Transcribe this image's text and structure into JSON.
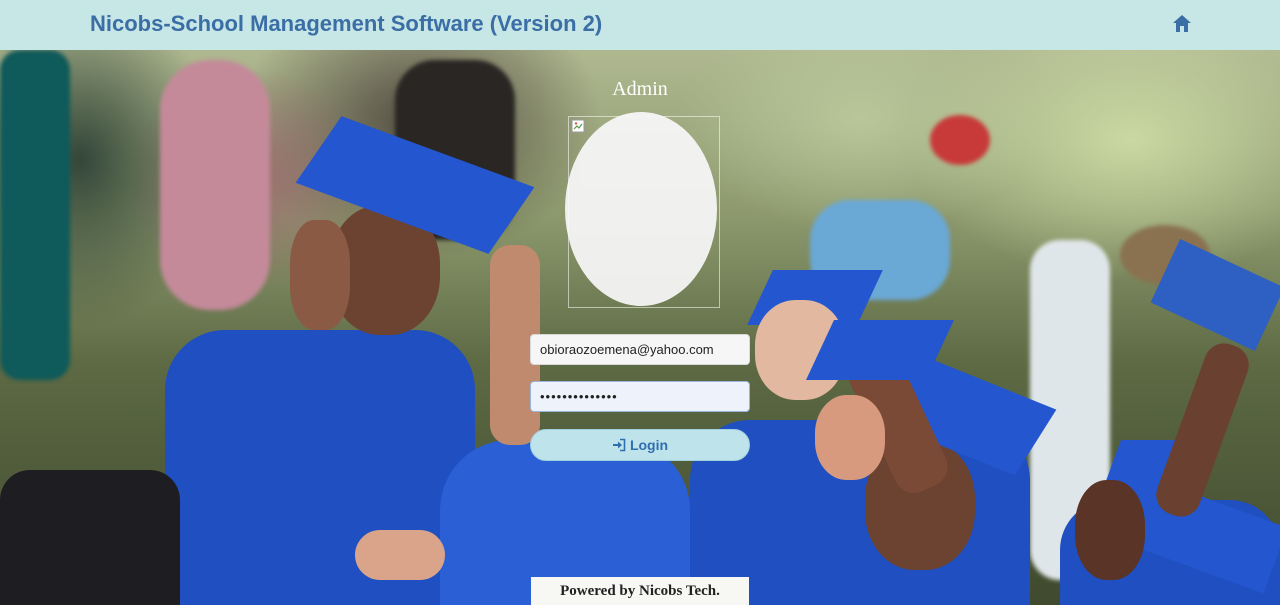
{
  "header": {
    "title": "Nicobs-School Management Software (Version 2)",
    "home_icon": "home-icon"
  },
  "login": {
    "heading": "Admin",
    "avatar_icon": "broken-image-icon",
    "email_value": "obioraozoemena@yahoo.com",
    "password_value": "••••••••••••••",
    "login_label": "Login",
    "login_icon": "sign-in-icon"
  },
  "footer": {
    "text": "Powered by Nicobs Tech."
  },
  "colors": {
    "header_bg": "#c7e6e6",
    "title_color": "#3a6ea5",
    "button_bg": "#bfe3ea",
    "button_text": "#2f6fb0"
  }
}
